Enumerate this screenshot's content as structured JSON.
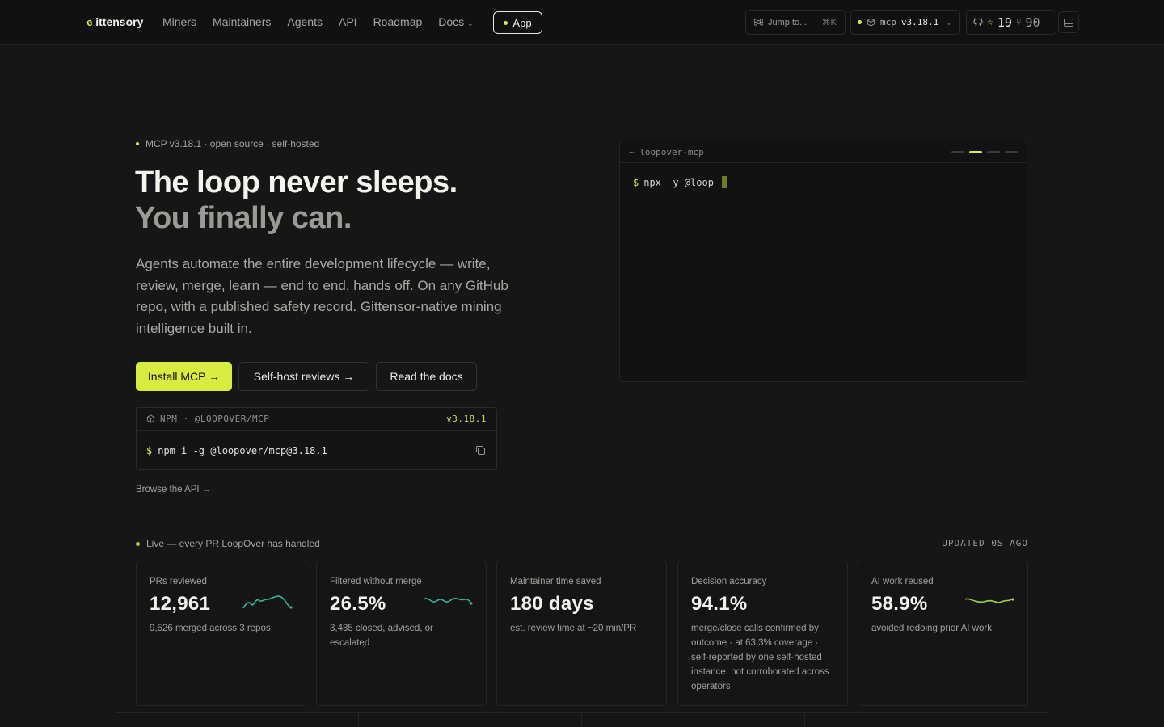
{
  "nav": {
    "logo": "ittensory",
    "links": [
      "Miners",
      "Maintainers",
      "Agents",
      "API",
      "Roadmap",
      "Docs"
    ],
    "app_label": "App",
    "jump_label": "Jump to...",
    "jump_shortcut": "⌘K",
    "version_prefix": "mcp",
    "version": "v3.18.1",
    "stars": "19",
    "forks": "90"
  },
  "hero": {
    "eyebrow": "MCP v3.18.1 · open source · self-hosted",
    "title_line1": "The loop never sleeps.",
    "title_line2": "You finally can.",
    "lead": "Agents automate the entire development lifecycle — write, review, merge, learn — end to end, hands off. On any GitHub repo, with a published safety record. Gittensor-native mining intelligence built in.",
    "btn_primary": "Install MCP →",
    "btn_selfhost": "Self-host reviews →",
    "btn_docs": "Read the docs",
    "npm_label": "NPM · @LOOPOVER/MCP",
    "npm_version": "v3.18.1",
    "npm_prompt": "$",
    "npm_command": "npm i -g @loopover/mcp@3.18.1",
    "browse_api": "Browse the API →"
  },
  "terminal": {
    "title": "~ loopover-mcp",
    "prompt": "$",
    "command": "npx -y @loop"
  },
  "stats": {
    "live_label": "Live — every PR LoopOver has handled",
    "updated": "UPDATED 0S AGO",
    "cards": [
      {
        "label": "PRs reviewed",
        "value": "12,961",
        "sub": "9,526 merged across 3 repos",
        "spark_color": "#2fb89a"
      },
      {
        "label": "Filtered without merge",
        "value": "26.5%",
        "sub": "3,435 closed, advised, or escalated",
        "spark_color": "#2fb89a"
      },
      {
        "label": "Maintainer time saved",
        "value": "180 days",
        "sub": "est. review time at ~20 min/PR"
      },
      {
        "label": "Decision accuracy",
        "value": "94.1%",
        "sub": "merge/close calls confirmed by outcome · at 63.3% coverage · self-reported by one self-hosted instance, not corroborated across operators"
      },
      {
        "label": "AI work reused",
        "value": "58.9%",
        "sub": "avoided redoing prior AI work",
        "spark_color": "#9bd43a"
      }
    ]
  },
  "colors": {
    "accent": "#d8ec3f",
    "background": "#161616",
    "nav_bg": "#111111"
  }
}
